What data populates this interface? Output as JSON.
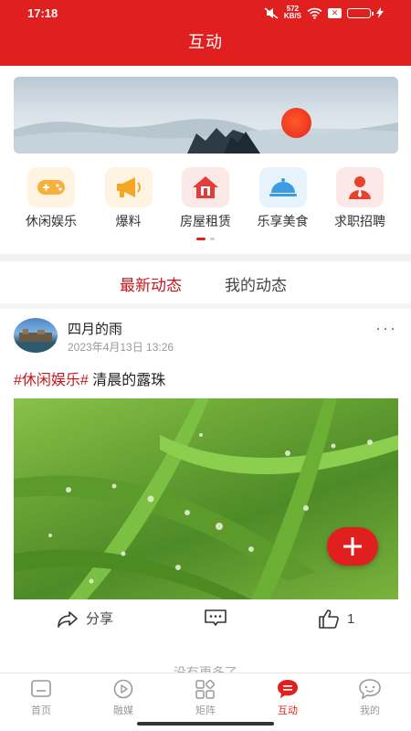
{
  "status_bar": {
    "time": "17:18",
    "net_speed": "572",
    "net_unit": "KB/S"
  },
  "header": {
    "title": "互动"
  },
  "categories": [
    {
      "label": "休闲娱乐",
      "icon": "gamepad-icon",
      "bg": "#fff4e1",
      "color": "#f7b03a"
    },
    {
      "label": "爆料",
      "icon": "megaphone-icon",
      "bg": "#fff4e1",
      "color": "#f5a623"
    },
    {
      "label": "房屋租赁",
      "icon": "house-icon",
      "bg": "#fde8e8",
      "color": "#e43b3b"
    },
    {
      "label": "乐享美食",
      "icon": "food-cloche-icon",
      "bg": "#e6f2fc",
      "color": "#3e9be0"
    },
    {
      "label": "求职招聘",
      "icon": "job-person-icon",
      "bg": "#fde8e8",
      "color": "#e4432e"
    }
  ],
  "tabs": [
    {
      "label": "最新动态",
      "active": true
    },
    {
      "label": "我的动态",
      "active": false
    }
  ],
  "post": {
    "author": "四月的雨",
    "time": "2023年4月13日 13:26",
    "more": "···",
    "tag": "#休闲娱乐#",
    "text": " 清晨的露珠",
    "share_label": "分享",
    "like_count": "1"
  },
  "feed_end": "没有更多了",
  "bottom_nav": [
    {
      "label": "首页",
      "icon": "home-icon",
      "active": false
    },
    {
      "label": "融媒",
      "icon": "play-circle-icon",
      "active": false
    },
    {
      "label": "矩阵",
      "icon": "matrix-grid-icon",
      "active": false
    },
    {
      "label": "互动",
      "icon": "interact-chat-icon",
      "active": true
    },
    {
      "label": "我的",
      "icon": "profile-chat-icon",
      "active": false
    }
  ],
  "colors": {
    "brand": "#e01f1f",
    "tab_active": "#c8161d"
  }
}
